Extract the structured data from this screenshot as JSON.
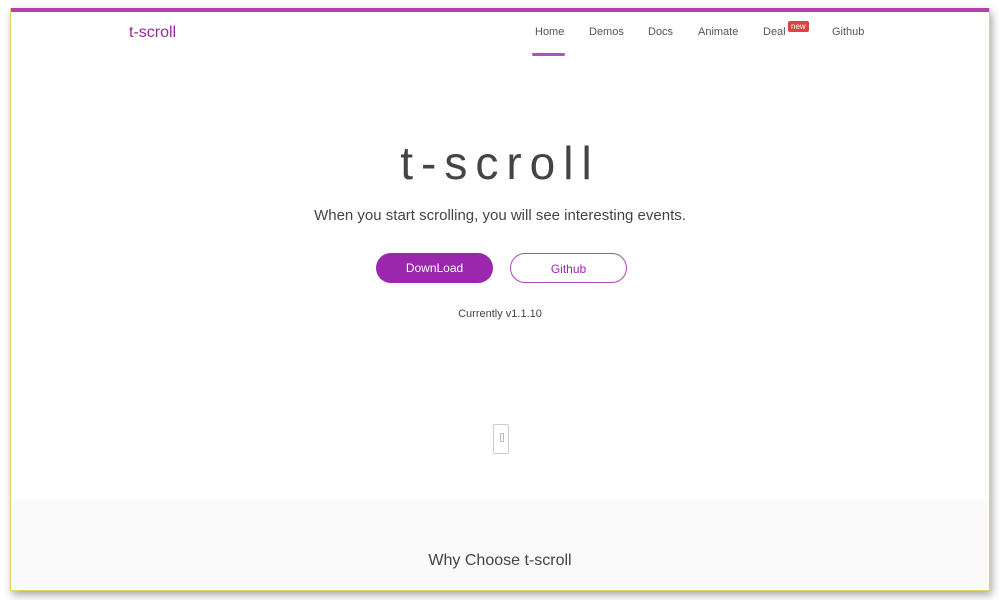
{
  "nav": {
    "brand": "t-scroll",
    "items": [
      {
        "label": "Home",
        "active": true
      },
      {
        "label": "Demos"
      },
      {
        "label": "Docs"
      },
      {
        "label": "Animate"
      },
      {
        "label": "Deal",
        "badge": "new"
      },
      {
        "label": "Github"
      }
    ]
  },
  "hero": {
    "title": "t-scroll",
    "tagline": "When you start scrolling, you will see interesting events.",
    "download_label": "DownLoad",
    "github_label": "Github",
    "version": "Currently v1.1.10",
    "scroll_icon": "mouse-scroll-icon"
  },
  "section": {
    "heading": "Why Choose t-scroll"
  },
  "colors": {
    "accent": "#9b27ae",
    "topbar": "#b83fa6",
    "badge": "#d9443f"
  }
}
